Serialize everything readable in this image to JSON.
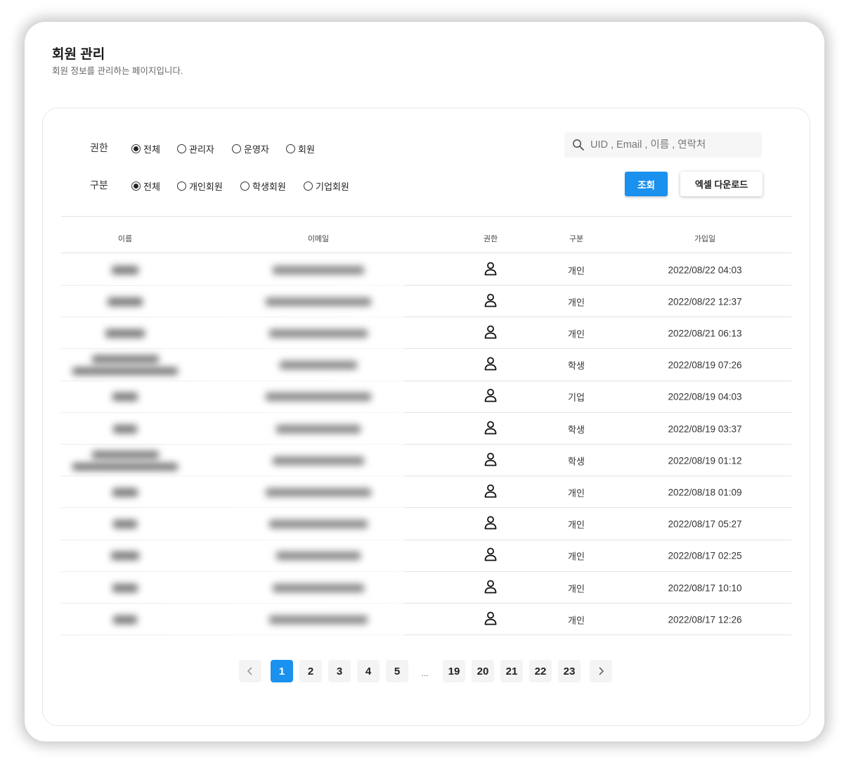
{
  "header": {
    "title": "회원 관리",
    "description": "회원 정보를 관리하는 페이지입니다."
  },
  "filters": {
    "role": {
      "label": "권한",
      "options": [
        "전체",
        "관리자",
        "운영자",
        "회원"
      ],
      "selected": "전체"
    },
    "category": {
      "label": "구분",
      "options": [
        "전체",
        "개인회원",
        "학생회원",
        "기업회원"
      ],
      "selected": "전체"
    }
  },
  "search": {
    "placeholder": "UID , Email , 이름 , 연락처",
    "value": ""
  },
  "buttons": {
    "search": "조회",
    "excel": "엑셀 다운로드"
  },
  "table": {
    "columns": [
      "이름",
      "이메일",
      "권한",
      "구분",
      "가입일"
    ],
    "rows": [
      {
        "type": "개인",
        "date": "2022/08/22 04:03"
      },
      {
        "type": "개인",
        "date": "2022/08/22 12:37"
      },
      {
        "type": "개인",
        "date": "2022/08/21 06:13"
      },
      {
        "type": "학생",
        "date": "2022/08/19 07:26"
      },
      {
        "type": "기업",
        "date": "2022/08/19 04:03"
      },
      {
        "type": "학생",
        "date": "2022/08/19 03:37"
      },
      {
        "type": "학생",
        "date": "2022/08/19 01:12"
      },
      {
        "type": "개인",
        "date": "2022/08/18 01:09"
      },
      {
        "type": "개인",
        "date": "2022/08/17 05:27"
      },
      {
        "type": "개인",
        "date": "2022/08/17 02:25"
      },
      {
        "type": "개인",
        "date": "2022/08/17 10:10"
      },
      {
        "type": "개인",
        "date": "2022/08/17 12:26"
      }
    ],
    "role_icon": "user-icon"
  },
  "pagination": {
    "pages_left": [
      "1",
      "2",
      "3",
      "4",
      "5"
    ],
    "ellipsis": "...",
    "pages_right": [
      "19",
      "20",
      "21",
      "22",
      "23"
    ],
    "current": "1",
    "prev_icon": "chevron-left-icon",
    "next_icon": "chevron-right-icon"
  },
  "colors": {
    "accent": "#1a90ef"
  }
}
